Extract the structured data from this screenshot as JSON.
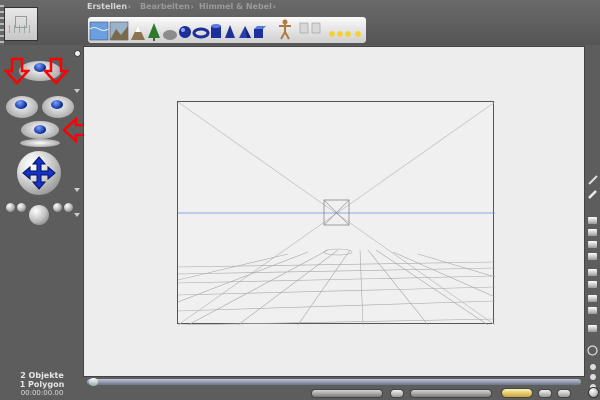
{
  "menu": {
    "items": [
      {
        "label": "Erstellen",
        "active": true
      },
      {
        "label": "Bearbeiten",
        "active": false
      },
      {
        "label": "Himmel & Nebel",
        "active": false
      }
    ],
    "separator": "›"
  },
  "object_shelf": {
    "items": [
      "water-icon",
      "terrain-icon",
      "mountain-icon",
      "tree-icon",
      "rock-icon",
      "sphere-icon",
      "torus-icon",
      "cylinder-icon",
      "cone-icon",
      "pyramid-icon",
      "cube-icon",
      "figure-icon",
      "light-icon",
      "light-icon",
      "light-icon",
      "light-icon",
      "light-icon"
    ]
  },
  "status": {
    "objects": "2 Objekte",
    "polygons": "1 Polygon",
    "time": "00:00:00.00"
  },
  "colors": {
    "background": "#5d5d5d",
    "document": "#ededed",
    "horizon": "#6b8ee8",
    "annotation_red": "#ff0000",
    "accent_blue": "#0a2c9a"
  }
}
